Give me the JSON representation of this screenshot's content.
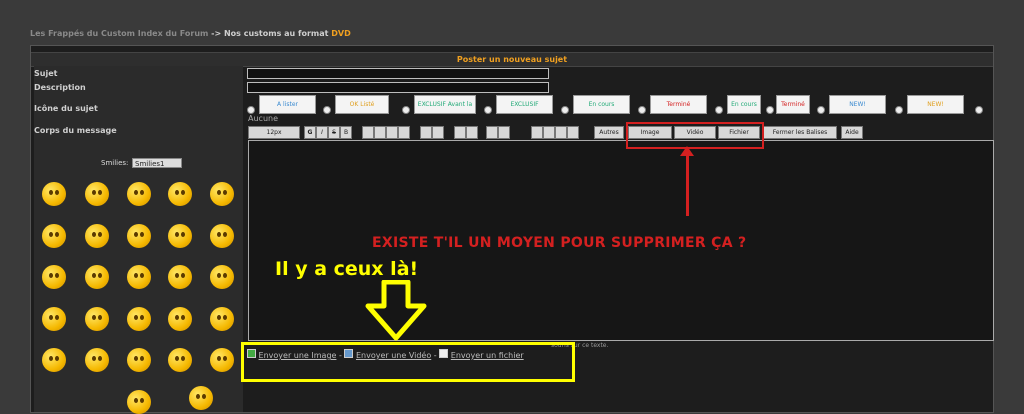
{
  "breadcrumb": {
    "part1": "Les Frappés du Custom Index du Forum",
    "separator": "->",
    "part2": "Nos customs au format",
    "accent": "DVD"
  },
  "form": {
    "title": "Poster un nouveau sujet",
    "labels": {
      "subject": "Sujet",
      "description": "Description",
      "icon": "Icône du sujet",
      "body": "Corps du message"
    },
    "icon_options": [
      "A lister",
      "OK Listé",
      "EXCLUSIF Avant la sortie",
      "EXCLUSIF",
      "En cours Commande acceptée",
      "Terminé Commande réalisée",
      "En cours",
      "Terminé",
      "NEW!",
      "NEW!"
    ],
    "icon_none": "Aucune",
    "toolbar": [
      "12px",
      "G",
      "I",
      "S",
      "B",
      "Autres",
      "Image",
      "Vidéo",
      "Fichier",
      "Fermer les Balises",
      "Aide"
    ],
    "smilies_label": "Smilies:",
    "smilies_select": "Smilies1",
    "hint": "souris sur ce texte.",
    "attach": {
      "image": "Envoyer une Image",
      "video": "Envoyer une Vidéo",
      "file": "Envoyer un fichier",
      "sep": "-"
    }
  },
  "annotations": {
    "question": "EXISTE T'IL UN MOYEN POUR SUPPRIMER ÇA ?",
    "answer": "Il y a ceux là!",
    "red_color": "#d42020",
    "yellow_color": "#ffff00"
  }
}
